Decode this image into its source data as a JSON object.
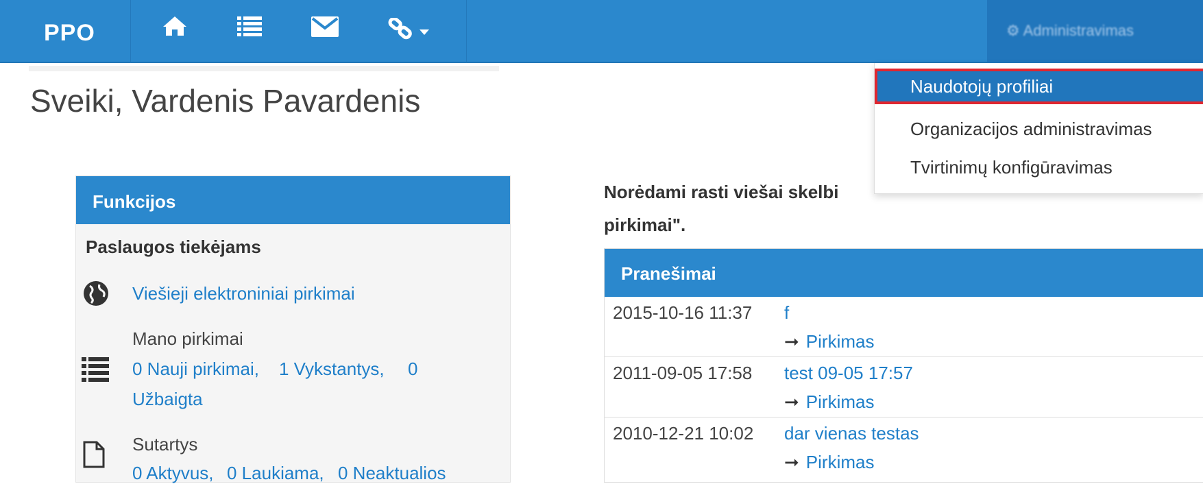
{
  "navbar": {
    "brand": "PPO",
    "icons": [
      "home-icon",
      "list-icon",
      "envelope-icon",
      "link-icon",
      "caret-down-icon"
    ],
    "admin_label": "Administravimas",
    "colors": {
      "bar": "#2b88cd",
      "admin_bg": "#2176bc"
    }
  },
  "greeting": "Sveiki, Vardenis Pavardenis",
  "dropdown": {
    "items": [
      {
        "label": "Naudotojų profiliai",
        "highlighted": true
      },
      {
        "label": "Organizacijos administravimas",
        "highlighted": false
      },
      {
        "label": "Tvirtinimų konfigūravimas",
        "highlighted": false
      }
    ]
  },
  "functions": {
    "title": "Funkcijos",
    "section": "Paslaugos tiekėjams",
    "public_purchases": "Viešieji elektroniniai pirkimai",
    "my_purchases": {
      "label": "Mano pirkimai",
      "new": "0 Nauji pirkimai,",
      "ongoing": "1 Vykstantys,",
      "completed_count": "0",
      "completed": "Užbaigta"
    },
    "contracts": {
      "label": "Sutartys",
      "active": "0 Aktyvus,",
      "pending": "0 Laukiama,",
      "outdated": "0 Neaktualios"
    }
  },
  "intro": {
    "line1": "Norėdami rasti viešai skelbi",
    "line2": "pirkimai\"."
  },
  "announcements": {
    "title": "Pranešimai",
    "rows": [
      {
        "date": "2015-10-16 11:37",
        "title": "f",
        "link": "Pirkimas"
      },
      {
        "date": "2011-09-05 17:58",
        "title": "test 09-05 17:57",
        "link": "Pirkimas"
      },
      {
        "date": "2010-12-21 10:02",
        "title": "dar vienas testas",
        "link": "Pirkimas"
      }
    ]
  }
}
